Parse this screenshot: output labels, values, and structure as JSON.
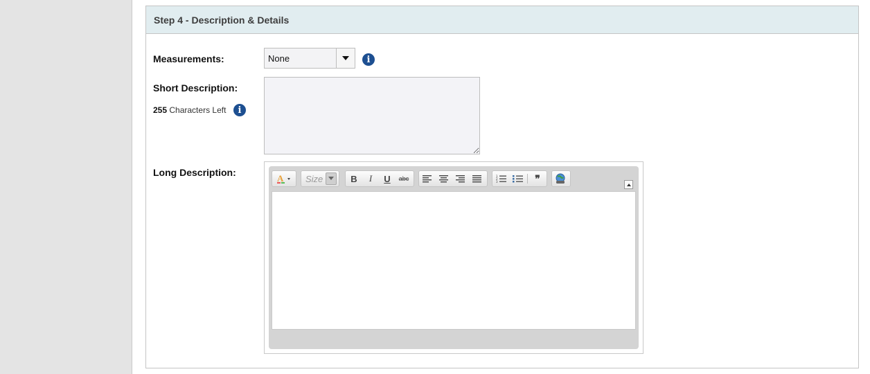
{
  "panel": {
    "title": "Step 4 - Description & Details"
  },
  "measurements": {
    "label": "Measurements:",
    "selected": "None",
    "info_icon": "info-icon"
  },
  "short_description": {
    "label": "Short Description:",
    "chars_left_count": "255",
    "chars_left_text": "Characters Left",
    "value": "",
    "info_icon": "info-icon"
  },
  "long_description": {
    "label": "Long Description:",
    "toolbar": {
      "font_color_icon": "font-color-icon",
      "size_placeholder": "Size",
      "bold": "B",
      "italic": "I",
      "underline": "U",
      "strikethrough": "abc",
      "align_left_icon": "align-left-icon",
      "align_center_icon": "align-center-icon",
      "align_right_icon": "align-right-icon",
      "justify_icon": "justify-icon",
      "ordered_list_icon": "ordered-list-icon",
      "unordered_list_icon": "unordered-list-icon",
      "blockquote": "❞",
      "insert_link_icon": "globe-link-icon"
    },
    "value": ""
  },
  "colors": {
    "header_bg": "#e1edf0",
    "info_icon": "#1d4f91",
    "gutter_bg": "#e4e4e4"
  }
}
